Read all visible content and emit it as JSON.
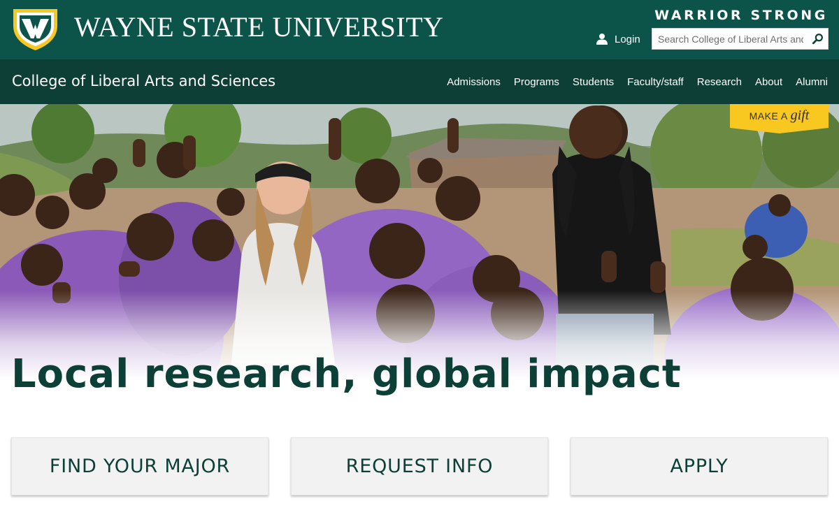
{
  "header": {
    "university_name": "WAYNE STATE UNIVERSITY",
    "tagline": "WARRIOR STRONG",
    "login_label": "Login",
    "search_placeholder": "Search College of Liberal Arts and Sciences",
    "logo_icon": "wayne-state-w-shield-icon",
    "colors": {
      "primary_green": "#0c5449",
      "dark_green": "#0d3f36",
      "gold": "#f9c820"
    }
  },
  "college_bar": {
    "college_name": "College of Liberal Arts and Sciences",
    "nav": [
      {
        "label": "Admissions"
      },
      {
        "label": "Programs"
      },
      {
        "label": "Students"
      },
      {
        "label": "Faculty/staff"
      },
      {
        "label": "Research"
      },
      {
        "label": "About"
      },
      {
        "label": "Alumni"
      }
    ]
  },
  "hero": {
    "gift_prefix": "MAKE A",
    "gift_word": "gift",
    "headline": "Local research, global impact"
  },
  "cta_buttons": [
    {
      "label": "FIND YOUR MAJOR"
    },
    {
      "label": "REQUEST INFO"
    },
    {
      "label": "APPLY"
    }
  ]
}
